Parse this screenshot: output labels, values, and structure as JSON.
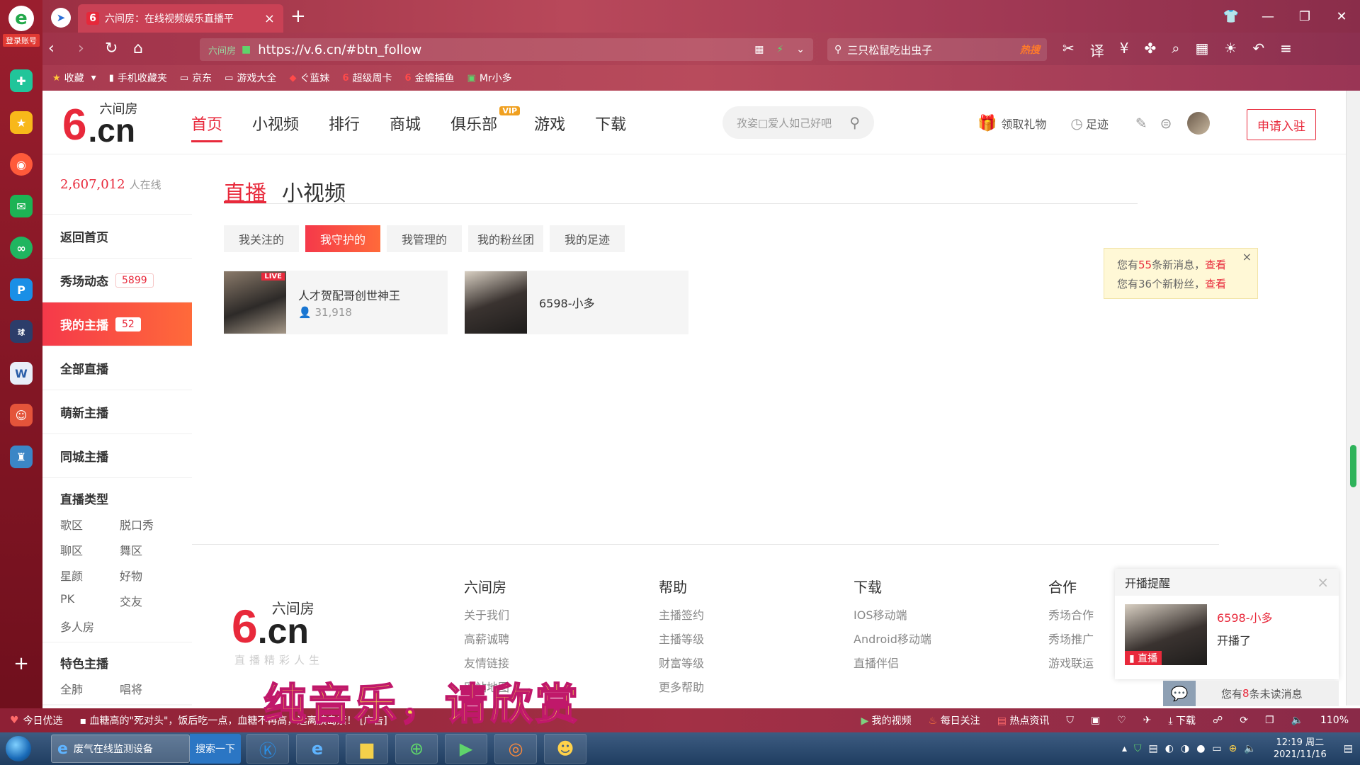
{
  "sidebar_left": {
    "login_label": "登录账号",
    "icons": [
      "calculator-icon",
      "favorites-star-icon",
      "weibo-icon",
      "mail-icon",
      "iqiyi-icon",
      "pp-icon",
      "news-icon",
      "word-icon",
      "game-icon",
      "game2-icon"
    ],
    "add_label": "+",
    "menu_label": "≡"
  },
  "browser": {
    "tab_title": "六间房：在线视频娱乐直播平",
    "tab_close": "×",
    "new_tab": "+",
    "url_site": "六间房",
    "url": "https://v.6.cn/#btn_follow",
    "search_text": "三只松鼠吃出虫子",
    "search_hot": "热搜",
    "bookmarks": [
      {
        "icon": "★",
        "label": "收藏"
      },
      {
        "icon": "▮",
        "label": "手机收藏夹"
      },
      {
        "icon": "▭",
        "label": "京东"
      },
      {
        "icon": "▭",
        "label": "游戏大全"
      },
      {
        "icon": "◆",
        "label": "ぐ蓝妹"
      },
      {
        "icon": "6",
        "label": "超级周卡"
      },
      {
        "icon": "6",
        "label": "金蟾捕鱼"
      },
      {
        "icon": "▣",
        "label": "Mr小多"
      }
    ]
  },
  "site": {
    "logo_name": "六间房",
    "logo_six": "6",
    "logo_cn": ".cn",
    "nav": [
      "首页",
      "小视频",
      "排行",
      "商城",
      "俱乐部",
      "游戏",
      "下载"
    ],
    "vip": "VIP",
    "search_placeholder": "孜姿□爱人如己好吧",
    "gift": "领取礼物",
    "footprint": "足迹",
    "apply": "申请入驻"
  },
  "sidebar": {
    "online_count": "2,607,012",
    "online_label": "人在线",
    "items": [
      {
        "label": "返回首页",
        "badge": ""
      },
      {
        "label": "秀场动态",
        "badge": "5899"
      },
      {
        "label": "我的主播",
        "badge": "52"
      },
      {
        "label": "全部直播",
        "badge": ""
      },
      {
        "label": "萌新主播",
        "badge": ""
      },
      {
        "label": "同城主播",
        "badge": ""
      }
    ],
    "types_title": "直播类型",
    "types": [
      "歌区",
      "脱口秀",
      "聊区",
      "舞区",
      "星颜",
      "好物",
      "PK",
      "交友",
      "多人房"
    ],
    "special_title": "特色主播",
    "special_partial": [
      "全肺",
      "唱将"
    ]
  },
  "content": {
    "tabs": [
      "直播",
      "小视频"
    ],
    "subtabs": [
      "我关注的",
      "我守护的",
      "我管理的",
      "我的粉丝团",
      "我的足迹"
    ],
    "cards": [
      {
        "name": "人才贺配哥创世神王",
        "views": "31,918",
        "live": "LIVE"
      },
      {
        "name": "6598-小多",
        "views": "",
        "live": ""
      }
    ]
  },
  "notice": {
    "line1_pre": "您有",
    "line1_count": "55",
    "line1_mid": "条新消息，",
    "line1_link": "查看",
    "line2_pre": "您有36个新粉丝，",
    "line2_link": "查看",
    "close": "×"
  },
  "footer": {
    "logo_sub": "直播精彩人生",
    "columns": [
      {
        "heading": "六间房",
        "links": [
          "关于我们",
          "高薪诚聘",
          "友情链接",
          "网站地图"
        ]
      },
      {
        "heading": "帮助",
        "links": [
          "主播签约",
          "主播等级",
          "财富等级",
          "更多帮助"
        ]
      },
      {
        "heading": "下载",
        "links": [
          "IOS移动端",
          "Android移动端",
          "直播伴侣"
        ]
      },
      {
        "heading": "合作",
        "links": [
          "秀场合作",
          "秀场推广",
          "游戏联运"
        ]
      }
    ]
  },
  "popup": {
    "title": "开播提醒",
    "close": "×",
    "anchor": "6598-小多",
    "text": "开播了",
    "live": "直播"
  },
  "unread": {
    "pre": "您有",
    "count": "8",
    "post": "条未读消息"
  },
  "overlay": "纯音乐，请欣赏",
  "statusbar": {
    "today": "今日优选",
    "news": "血糖高的\"死对头\"，饭后吃一点，血糖不再高，远离胰岛素！ [广告]",
    "right": [
      "我的视频",
      "每日关注",
      "热点资讯",
      "下载",
      "110%"
    ]
  },
  "taskbar": {
    "task_label": "废气在线监测设备",
    "search_btn": "搜索一下",
    "time": "12:19 周二",
    "date": "2021/11/16",
    "apps": [
      "kugou-icon",
      "ie-icon",
      "folder-icon",
      "browser-icon",
      "player-icon",
      "colorful-icon",
      "chat-icon"
    ]
  },
  "colors": {
    "brand_red": "#e8293b",
    "browser_maroon": "#a33045",
    "notice_bg": "#fff8d6"
  }
}
